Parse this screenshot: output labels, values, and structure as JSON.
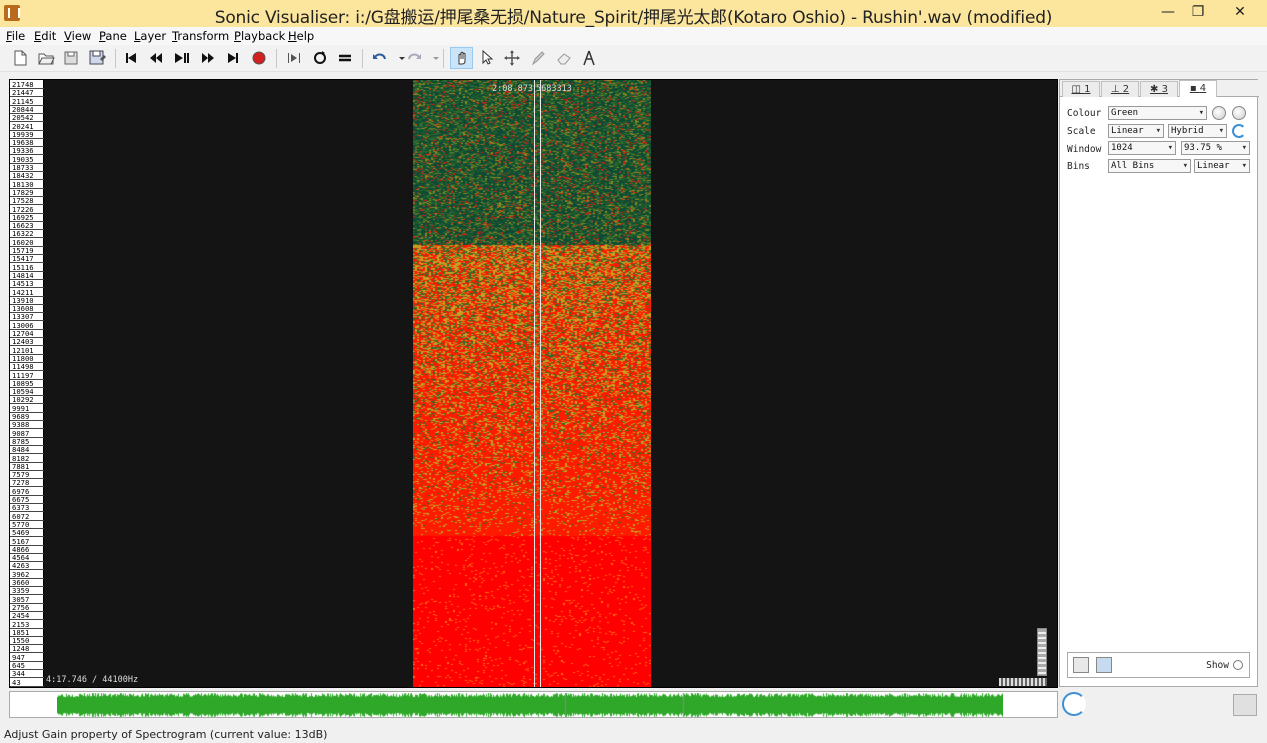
{
  "window": {
    "title": "Sonic Visualiser: i:/G盘搬运/押尾桑无损/Nature_Spirit/押尾光太郎(Kotaro Oshio) - Rushin'.wav (modified)",
    "minimize": "—",
    "maximize": "❐",
    "close": "✕"
  },
  "menu": [
    "File",
    "Edit",
    "View",
    "Pane",
    "Layer",
    "Transform",
    "Playback",
    "Help"
  ],
  "toolbar": {
    "icons": [
      "new-icon",
      "open-icon",
      "save-icon",
      "save-as-icon",
      "rewind-start-icon",
      "rewind-icon",
      "play-pause-icon",
      "fast-forward-icon",
      "ffwd-end-icon",
      "record-icon",
      "play-selection-icon",
      "loop-icon",
      "solo-icon",
      "undo-icon",
      "redo-icon",
      "navigate-icon",
      "select-icon",
      "move-icon",
      "draw-icon",
      "erase-icon",
      "measure-icon"
    ]
  },
  "pane": {
    "scale_labels": [
      "21748",
      "21447",
      "21145",
      "20844",
      "20542",
      "20241",
      "19939",
      "19638",
      "19336",
      "19035",
      "18733",
      "18432",
      "18130",
      "17829",
      "17528",
      "17226",
      "16925",
      "16623",
      "16322",
      "16020",
      "15719",
      "15417",
      "15116",
      "14814",
      "14513",
      "14211",
      "13910",
      "13608",
      "13307",
      "13006",
      "12704",
      "12403",
      "12101",
      "11800",
      "11498",
      "11197",
      "10895",
      "10594",
      "10292",
      "9991",
      "9689",
      "9388",
      "9087",
      "8785",
      "8484",
      "8182",
      "7881",
      "7579",
      "7278",
      "6976",
      "6675",
      "6373",
      "6072",
      "5770",
      "5469",
      "5167",
      "4866",
      "4564",
      "4263",
      "3962",
      "3660",
      "3359",
      "3057",
      "2756",
      "2454",
      "2153",
      "1851",
      "1550",
      "1248",
      "947",
      "645",
      "344",
      "43"
    ],
    "time_readout": "2:08.873",
    "frame_readout": "5683313",
    "duration_readout": "4:17.746 / 44100Hz"
  },
  "layer_tabs": [
    "1",
    "2",
    "3",
    "4"
  ],
  "properties": {
    "colour_label": "Colour",
    "colour_value": "Green",
    "scale_label": "Scale",
    "scale_value": "Linear",
    "scale_mode": "Hybrid",
    "window_label": "Window",
    "window_value": "1024",
    "overlap_value": "93.75 %",
    "bins_label": "Bins",
    "bins_value": "All Bins",
    "bins_mode": "Linear",
    "show_label": "Show"
  },
  "status": "Adjust Gain property of Spectrogram (current value: 13dB)",
  "colors": {
    "spectro_high": "#ff0000",
    "spectro_mid": "#c9a020",
    "spectro_low": "#0e4a34",
    "wave": "#2fa82a",
    "background": "#141414"
  }
}
